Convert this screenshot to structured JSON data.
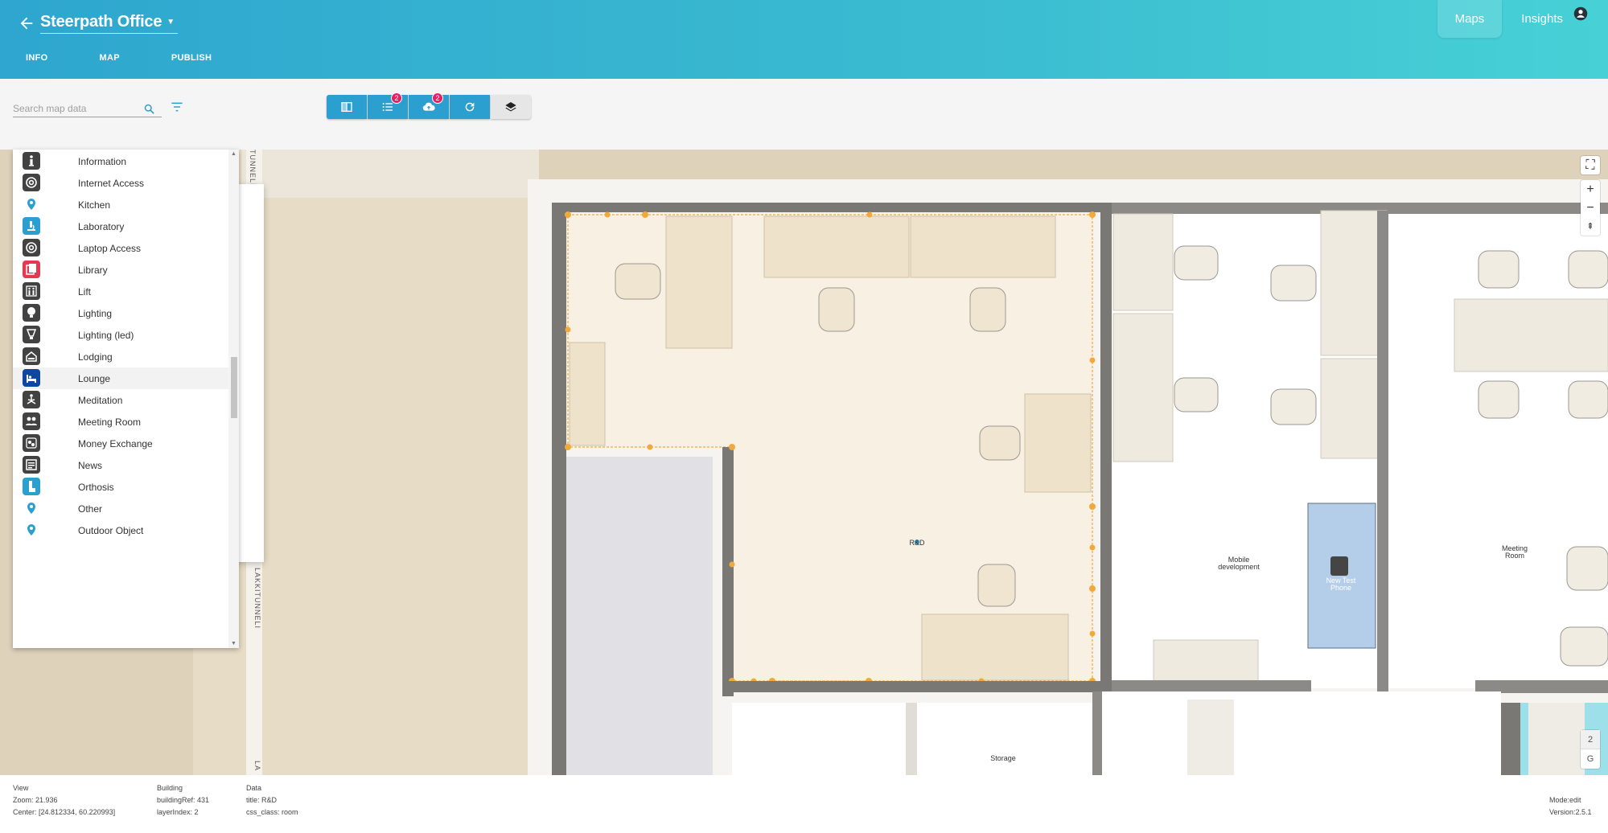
{
  "header": {
    "title": "Steerpath Office",
    "tabs": [
      "INFO",
      "MAP",
      "PUBLISH"
    ],
    "nav": {
      "maps": "Maps",
      "insights": "Insights"
    }
  },
  "search": {
    "placeholder": "Search map data"
  },
  "toolbar": {
    "list_badge": "2",
    "upload_badge": "2"
  },
  "categories": [
    {
      "label": "Information",
      "icon": "information-icon",
      "bg": "#424242"
    },
    {
      "label": "Internet Access",
      "icon": "at-sign-icon",
      "bg": "#424242"
    },
    {
      "label": "Kitchen",
      "icon": "map-pin-icon",
      "bg": ""
    },
    {
      "label": "Laboratory",
      "icon": "microscope-icon",
      "bg": "#2b9fcf"
    },
    {
      "label": "Laptop Access",
      "icon": "at-sign-icon",
      "bg": "#424242"
    },
    {
      "label": "Library",
      "icon": "books-icon",
      "bg": "#e53952"
    },
    {
      "label": "Lift",
      "icon": "elevator-icon",
      "bg": "#424242"
    },
    {
      "label": "Lighting",
      "icon": "lightbulb-icon",
      "bg": "#424242"
    },
    {
      "label": "Lighting (led)",
      "icon": "led-bulb-icon",
      "bg": "#424242"
    },
    {
      "label": "Lodging",
      "icon": "house-icon",
      "bg": "#424242"
    },
    {
      "label": "Lounge",
      "icon": "bed-icon",
      "bg": "#0d47a1"
    },
    {
      "label": "Meditation",
      "icon": "meditation-icon",
      "bg": "#424242"
    },
    {
      "label": "Meeting Room",
      "icon": "people-icon",
      "bg": "#424242"
    },
    {
      "label": "Money Exchange",
      "icon": "money-exchange-icon",
      "bg": "#424242"
    },
    {
      "label": "News",
      "icon": "news-icon",
      "bg": "#424242"
    },
    {
      "label": "Orthosis",
      "icon": "orthosis-icon",
      "bg": "#2b9fcf"
    },
    {
      "label": "Other",
      "icon": "map-pin-icon",
      "bg": ""
    },
    {
      "label": "Outdoor Object",
      "icon": "map-pin-icon",
      "bg": ""
    }
  ],
  "highlighted_category": "Lounge",
  "map": {
    "streets": [
      "TUNNELI",
      "LAKKITUNNELI",
      "LA"
    ],
    "rooms": {
      "rd": "R&D",
      "mobile": "Mobile development",
      "test_phone": "New Test Phone",
      "meeting": "Meeting Room",
      "storage": "Storage"
    },
    "floors": [
      "2",
      "G"
    ],
    "active_floor": "2"
  },
  "status": {
    "view": {
      "heading": "View",
      "zoom": "Zoom: 21.936",
      "center": "Center: [24.812334, 60.220993]"
    },
    "building": {
      "heading": "Building",
      "ref": "buildingRef: 431",
      "layer": "layerIndex: 2"
    },
    "data": {
      "heading": "Data",
      "title": "title: R&D",
      "css_class": "css_class: room"
    },
    "mode": "Mode:edit",
    "version": "Version:2.5.1"
  },
  "colors": {
    "header_start": "#2ea6cf",
    "header_end": "#47d1d6",
    "accent": "#2b9fcf",
    "badge": "#e91e63",
    "selection": "#f2a93b"
  }
}
